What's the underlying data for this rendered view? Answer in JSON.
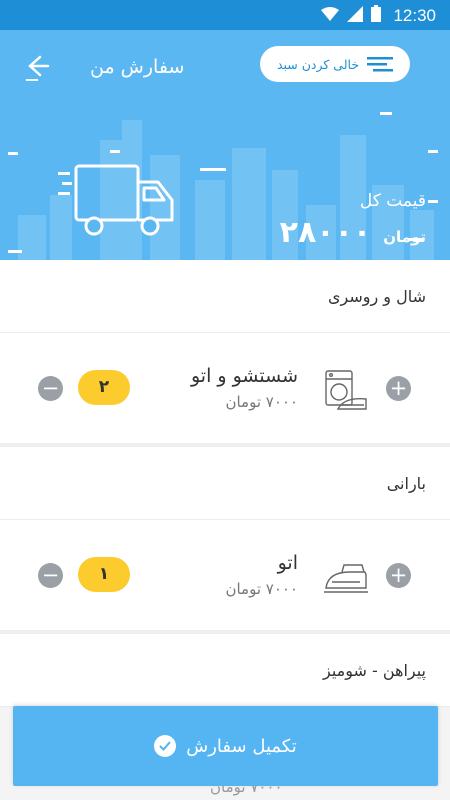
{
  "status_bar": {
    "time": "12:30"
  },
  "header": {
    "title": "سفارش من",
    "clear_label": "خالی کردن سبد",
    "total_label": "قیمت کل",
    "total_amount": "۲۸۰۰۰",
    "total_currency": "تومان"
  },
  "sections": [
    {
      "category": "شال و روسری",
      "item": {
        "name": "شستشو و اتو",
        "price": "۷۰۰۰ تومان",
        "qty": "۲",
        "icon": "washer-ironing-icon"
      }
    },
    {
      "category": "بارانی",
      "item": {
        "name": "اتو",
        "price": "۷۰۰۰ تومان",
        "qty": "۱",
        "icon": "iron-icon"
      }
    },
    {
      "category": "پیراهن - شومیز"
    }
  ],
  "ghost_price": "۷۰۰۰ تومان",
  "footer": {
    "label": "تکمیل سفارش"
  },
  "colors": {
    "primary": "#5bb7f2",
    "status_bar": "#1e8fd6",
    "badge": "#fccb2e",
    "button": "#55b4f2"
  }
}
